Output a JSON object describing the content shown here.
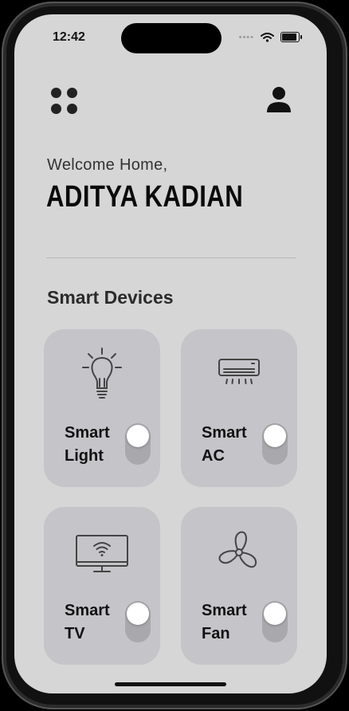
{
  "status_bar": {
    "time": "12:42",
    "dots": "••••"
  },
  "header": {
    "welcome": "Welcome Home,",
    "user_name": "ADITYA KADIAN"
  },
  "section": {
    "title": "Smart Devices"
  },
  "devices": [
    {
      "line1": "Smart",
      "line2": "Light",
      "icon": "lightbulb-icon",
      "on": false
    },
    {
      "line1": "Smart",
      "line2": "AC",
      "icon": "air-conditioner-icon",
      "on": false
    },
    {
      "line1": "Smart",
      "line2": "TV",
      "icon": "smart-tv-icon",
      "on": false
    },
    {
      "line1": "Smart",
      "line2": "Fan",
      "icon": "fan-icon",
      "on": false
    }
  ],
  "colors": {
    "background": "#d6d6d6",
    "card": "#c5c4c8",
    "toggle_track": "#a9a8ad",
    "text": "#111111"
  }
}
